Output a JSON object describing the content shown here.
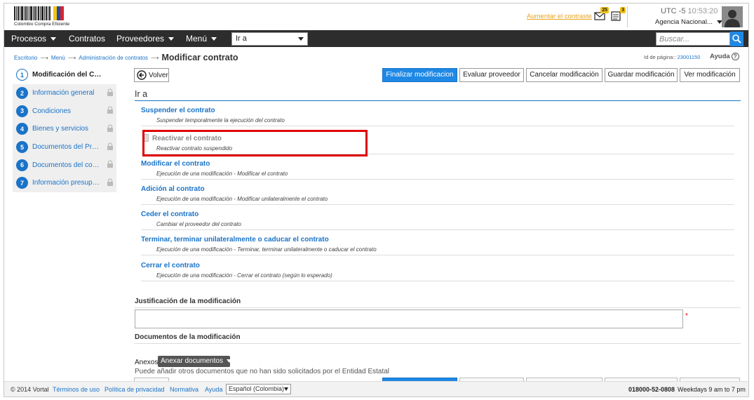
{
  "header": {
    "logo_text": "Colombio Compra Eficiente",
    "contrast_link": "Aumentar el contraste",
    "mail_count": "25",
    "notif_count": "3",
    "timezone": "UTC -5",
    "time": "10:53:20",
    "agency": "Agencia Nacional..."
  },
  "nav": {
    "items": [
      "Procesos",
      "Contratos",
      "Proveedores",
      "Menú"
    ],
    "ira_value": "Ir a",
    "search_placeholder": "Buscar..."
  },
  "breadcrumb": {
    "items": [
      "Escritorio",
      "Menú",
      "Administración de contratos"
    ],
    "current": "Modificar contrato",
    "page_id_label": "Id de página::",
    "page_id": "23001150",
    "help": "Ayuda"
  },
  "steps": [
    {
      "num": "1",
      "label": "Modificación del Contrato"
    },
    {
      "num": "2",
      "label": "Información general"
    },
    {
      "num": "3",
      "label": "Condiciones"
    },
    {
      "num": "4",
      "label": "Bienes y servicios"
    },
    {
      "num": "5",
      "label": "Documentos del Prov..."
    },
    {
      "num": "6",
      "label": "Documentos del contr..."
    },
    {
      "num": "7",
      "label": "Información presupue..."
    }
  ],
  "toolbar": {
    "back": "Volver",
    "finalize": "Finalizar modificacion",
    "evaluate": "Evaluar proveedor",
    "cancel": "Cancelar modificación",
    "save": "Guardar modificación",
    "view": "Ver modificación"
  },
  "ira_section": {
    "title": "Ir a",
    "options": [
      {
        "title": "Suspender el contrato",
        "desc": "Suspender temporalmente la ejecución del contrato"
      },
      {
        "title": "Reactivar el contrato",
        "desc": "Reactivar contrato suspendido"
      },
      {
        "title": "Modificar el contrato",
        "desc": "Ejecución de una modificación - Modificar el contrato"
      },
      {
        "title": "Adición al contrato",
        "desc": "Ejecución de una modificación - Modificar unilateralmente el contrato"
      },
      {
        "title": "Ceder el contrato",
        "desc": "Cambiar el proveedor del contrato"
      },
      {
        "title": "Terminar, terminar unilateralmente o caducar el contrato",
        "desc": "Ejecución de una modificación - Terminar, terminar unilateralmente o caducar el contrato"
      },
      {
        "title": "Cerrar el contrato",
        "desc": "Ejecución de una modificación - Cerrar el contrato (según lo esperado)"
      }
    ]
  },
  "justification": {
    "label": "Justificación de la modificación",
    "required": "*"
  },
  "documents": {
    "label": "Documentos de la modificación",
    "anexos": "Anexos",
    "attach_button": "Anexar documentos",
    "hint": "Puede añadir otros documentos que no han sido solicitados por el Entidad Estatal"
  },
  "footer": {
    "copyright": "© 2014 Vortal",
    "links": [
      "Términos de uso",
      "Política de privacidad",
      "Normativa",
      "Ayuda"
    ],
    "language": "Español (Colombia)",
    "phone": "018000-52-0808",
    "hours": "Weekdays 9 am to 7 pm"
  },
  "colors": {
    "accent": "#1e88e5",
    "nav_bg": "#2d2d2d",
    "highlight": "#e00000",
    "link": "#1a73c8"
  }
}
